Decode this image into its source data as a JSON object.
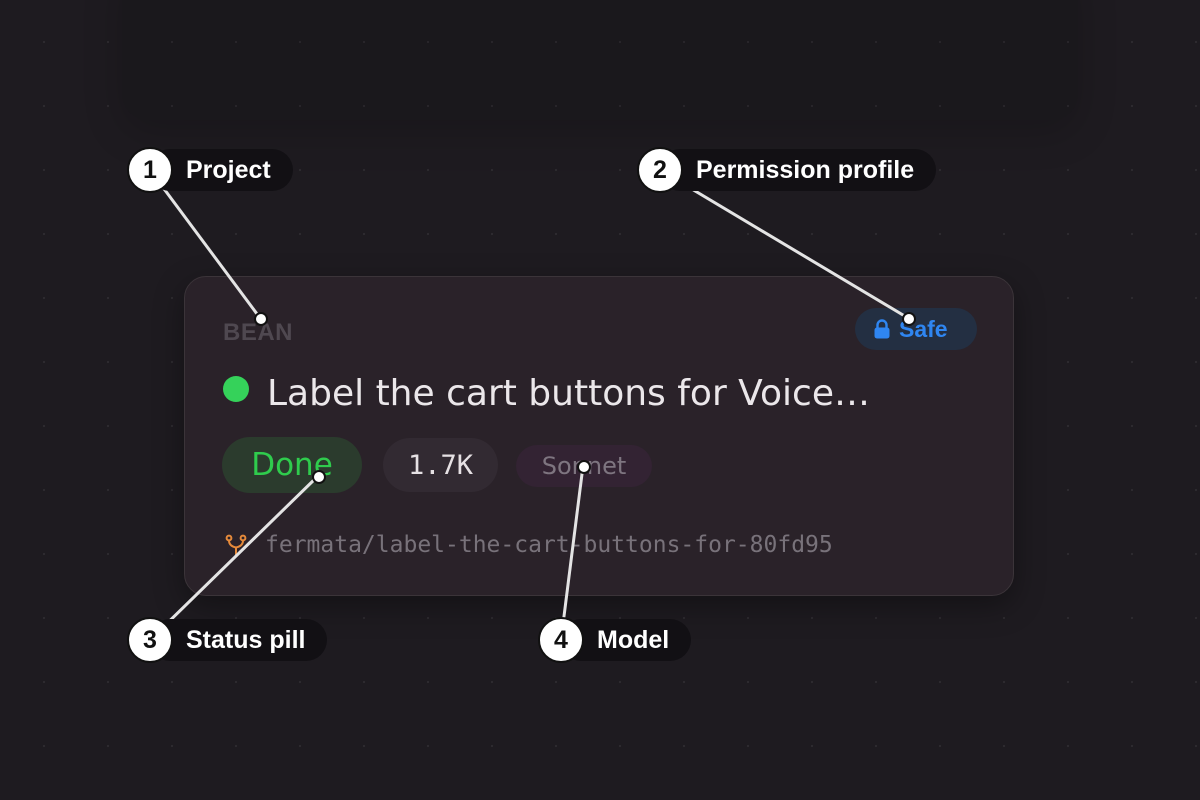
{
  "card": {
    "project": "BEAN",
    "permission_profile": "Safe",
    "permission_icon": "lock-icon",
    "title": "Label the cart buttons for Voice…",
    "status_dot_color": "#35d25a",
    "status": "Done",
    "tokens": "1.7K",
    "model": "Sonnet",
    "branch": "fermata/label-the-cart-buttons-for-80fd95",
    "branch_icon": "git-branch-icon"
  },
  "callouts": [
    {
      "number": "1",
      "label": "Project"
    },
    {
      "number": "2",
      "label": "Permission profile"
    },
    {
      "number": "3",
      "label": "Status pill"
    },
    {
      "number": "4",
      "label": "Model"
    }
  ],
  "colors": {
    "background": "#1e1b20",
    "card": "#2a2229",
    "accent_blue": "#2f86f1",
    "status_green": "#2fcc4d",
    "branch_orange": "#e58a3b"
  }
}
